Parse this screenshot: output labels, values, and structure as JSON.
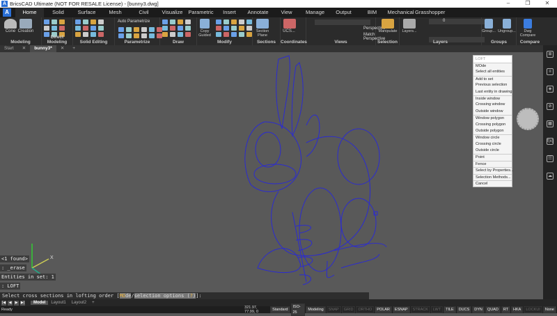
{
  "title": "BricsCAD Ultimate (NOT FOR RESALE License) - [bunny3.dwg]",
  "window_controls": [
    "–",
    "❐",
    "✕"
  ],
  "menu_tabs": [
    "Home",
    "Solid",
    "Surface",
    "Mesh",
    "Civil",
    "Visualize",
    "Parametric",
    "Insert",
    "Annotate",
    "View",
    "Manage",
    "Output",
    "BIM",
    "Mechanical",
    "Grasshopper"
  ],
  "active_tab": "Home",
  "ribbon": {
    "modeling": {
      "label": "Modeling",
      "cone": "Cone",
      "creation": "Creation"
    },
    "direct_modeling": {
      "label": "Direct Modeling"
    },
    "solid_editing": {
      "label": "Solid Editing"
    },
    "parametrize": {
      "label": "Parametrize",
      "auto": "Auto Parametrize"
    },
    "draw": {
      "label": "Draw"
    },
    "modify": {
      "label": "Modify",
      "copy_guided": "Copy Guided"
    },
    "sections": {
      "label": "Sections",
      "section_plane": "Section Plane"
    },
    "coordinates": {
      "label": "Coordinates",
      "ucs": "UCS..."
    },
    "views": {
      "label": "Views",
      "perspective": "Perspective",
      "match_perspective": "Match Perspective"
    },
    "selection": {
      "label": "Selection",
      "manipulate": "Manipulate"
    },
    "layers": {
      "label": "Layers",
      "layers_btn": "Layers...",
      "current_layer": "0"
    },
    "groups": {
      "label": "Groups",
      "group": "Group...",
      "ungroup": "Ungroup..."
    },
    "compare": {
      "label": "Compare",
      "dwg_compare": "Dwg Compare"
    }
  },
  "doc_tabs": {
    "start": "Start",
    "current": "bunny3*",
    "close": "✕",
    "add": "+"
  },
  "context_menu": {
    "header": "LOFT",
    "items": [
      [
        "MOde",
        "Select all entities"
      ],
      [
        "Add to set",
        "Previous selection",
        "Last entity in drawing"
      ],
      [
        "Inside window",
        "Crossing window",
        "Outside window"
      ],
      [
        "Window polygon",
        "Crossing polygon",
        "Outside polygon"
      ],
      [
        "Window circle",
        "Crossing circle",
        "Outside circle"
      ],
      [
        "Point"
      ],
      [
        "Fence"
      ],
      [
        "Select by Properties..."
      ],
      [
        "Selection Methods..."
      ],
      [
        "Cancel"
      ]
    ]
  },
  "history": [
    "<1 found>",
    ": _erase",
    "Entities in set: 1",
    ": LOFT"
  ],
  "command": {
    "prefix": "Select cross sections in lofting order [",
    "kw1": "MO",
    "kw1rest": "de",
    "slash": "/",
    "opt": "selection options (",
    "q": "?",
    "optend": ")",
    "suffix": "]:"
  },
  "ucs_axis": {
    "x": "X",
    "y": "Y"
  },
  "layout_tabs": [
    "Model",
    "Layout1",
    "Layout2",
    "+"
  ],
  "nav_buttons": [
    "|◀",
    "◀",
    "▶",
    "▶|"
  ],
  "status": {
    "ready": "Ready",
    "coords": "321.97, 77.99, 0",
    "toggles": [
      [
        "Standard",
        1
      ],
      [
        "ISO-25",
        1
      ],
      [
        "Modeling",
        1
      ],
      [
        "SNAP",
        0
      ],
      [
        "GRID",
        0
      ],
      [
        "ORTHO",
        0
      ],
      [
        "POLAR",
        1
      ],
      [
        "ESNAP",
        1
      ],
      [
        "STRACK",
        0
      ],
      [
        "LWT",
        0
      ],
      [
        "TILE",
        1
      ],
      [
        "DUCS",
        1
      ],
      [
        "DYN",
        1
      ],
      [
        "QUAD",
        1
      ],
      [
        "RT",
        1
      ],
      [
        "HKA",
        1
      ],
      [
        "LOCKUI",
        0
      ],
      [
        "None",
        1
      ]
    ]
  },
  "right_bar": [
    "⊞",
    "≡",
    "◈",
    "⊘",
    "▦",
    "f(x)",
    "☷",
    "☁"
  ],
  "colors": {
    "canvas": "#595959",
    "geometry": "#2b2bd0",
    "accent": "#2a6fd6"
  }
}
